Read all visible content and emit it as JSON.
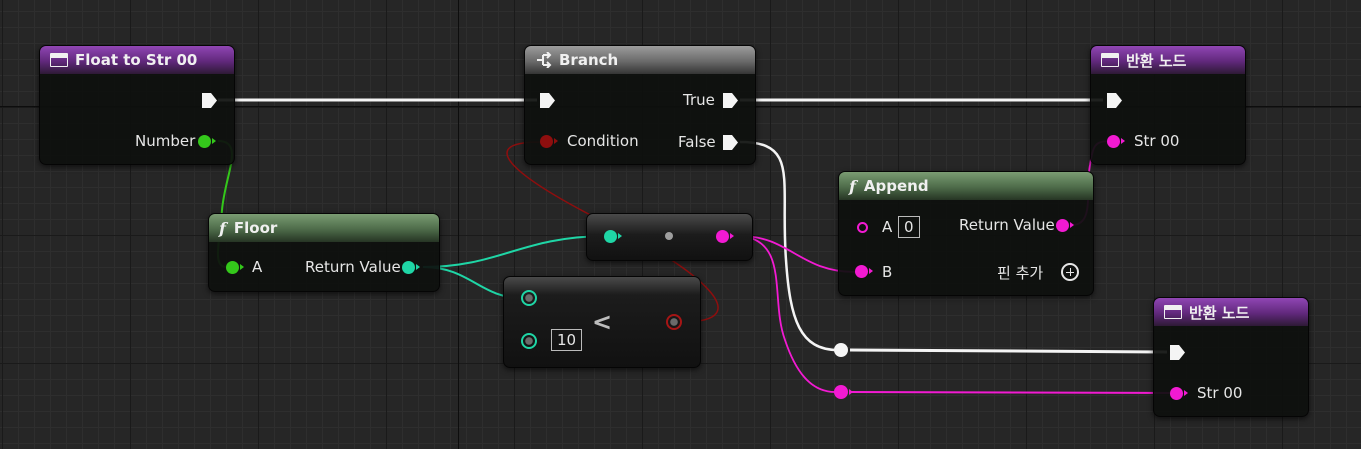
{
  "nodes": {
    "float_to_str": {
      "title": "Float to Str 00",
      "output_number_label": "Number"
    },
    "branch": {
      "title": "Branch",
      "condition_label": "Condition",
      "true_label": "True",
      "false_label": "False"
    },
    "return_top": {
      "title": "반환 노드",
      "str_label": "Str 00"
    },
    "floor": {
      "title": "Floor",
      "input_label": "A",
      "output_label": "Return Value"
    },
    "append": {
      "title": "Append",
      "input_a_label": "A",
      "input_a_value": "0",
      "input_b_label": "B",
      "output_label": "Return Value",
      "add_pin_label": "핀 추가"
    },
    "less_than": {
      "operator": "<",
      "input_b_value": "10"
    },
    "return_bottom": {
      "title": "반환 노드",
      "str_label": "Str 00"
    }
  },
  "colors": {
    "exec": "#f4f4f4",
    "float": "#34c81b",
    "integer": "#1fd6a6",
    "string": "#f21ad2",
    "boolean": "#8e0e0e",
    "function_entry_header": "#61287c",
    "pure_function_header": "#4d6b49",
    "flow_control_header": "#6a6a6a"
  },
  "icons": {
    "function_entry": "function-box-icon",
    "pure_function": "function-f-icon",
    "branch": "branch-icon",
    "add_pin": "plus-circle-icon"
  }
}
